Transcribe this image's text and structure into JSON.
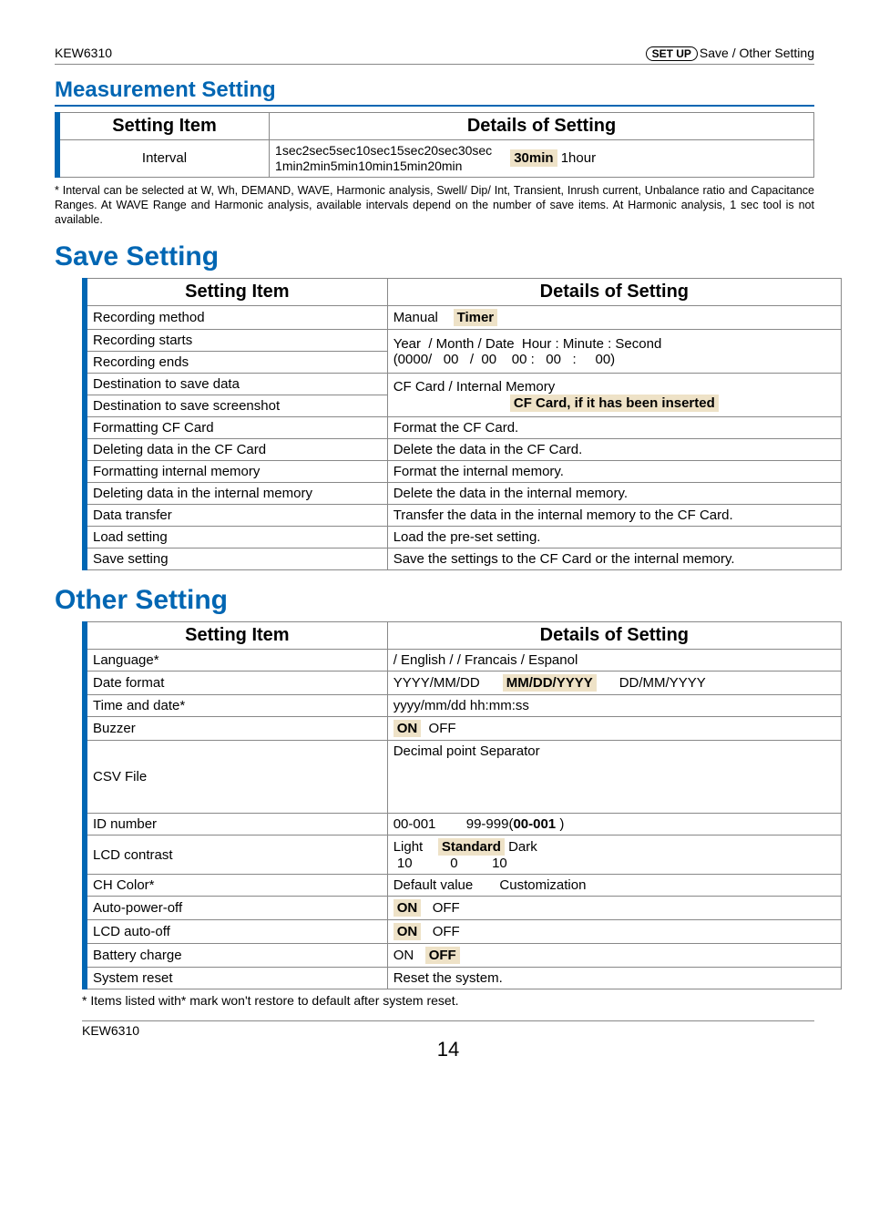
{
  "header": {
    "left": "KEW6310",
    "setup_label": "SET UP",
    "right_text": "Save / Other Setting"
  },
  "measurement": {
    "title": "Measurement Setting",
    "col1": "Setting Item",
    "col2": "Details of Setting",
    "row": {
      "item": "Interval",
      "line1": "1sec2sec5sec10sec15sec20sec30sec",
      "line2": "1min2min5min10min15min20min",
      "highlight": "30min",
      "after": " 1hour"
    },
    "footnote": "* Interval can be selected at W, Wh, DEMAND, WAVE, Harmonic analysis, Swell/ Dip/ Int, Transient, Inrush current, Unbalance ratio and Capacitance Ranges. At WAVE Range and Harmonic analysis, available intervals depend on the number of save items. At Harmonic analysis, 1 sec tool is not available."
  },
  "save": {
    "title": "Save Setting",
    "col1": "Setting Item",
    "col2": "Details of Setting",
    "rows": [
      {
        "item": "Recording method",
        "detail_pre": "Manual    ",
        "highlight": "Timer"
      },
      {
        "item": "Recording starts",
        "detail_plain": "Year  / Month / Date  Hour : Minute : Second"
      },
      {
        "item": "Recording ends",
        "detail_plain": "(0000/   00   /  00    00 :   00   :     00)"
      },
      {
        "item": "Destination to save data",
        "detail_plain": "CF Card / Internal Memory"
      },
      {
        "item": "Destination to save screenshot",
        "highlight_center": "CF Card, if it has been inserted"
      },
      {
        "item": "Formatting CF Card",
        "detail_plain": "Format the CF Card."
      },
      {
        "item": "Deleting data in the CF Card",
        "detail_plain": "Delete the data in the CF Card."
      },
      {
        "item": "Formatting internal memory",
        "detail_plain": "Format the internal memory."
      },
      {
        "item": "Deleting data in the internal memory",
        "detail_plain": "Delete the data in the internal memory."
      },
      {
        "item": "Data transfer",
        "detail_plain": "Transfer the data in the internal memory to the CF Card."
      },
      {
        "item": "Load setting",
        "detail_plain": "Load the pre-set setting."
      },
      {
        "item": "Save setting",
        "detail_plain": "Save the settings to the CF Card or the internal memory."
      }
    ]
  },
  "other": {
    "title": "Other Setting",
    "col1": "Setting Item",
    "col2": "Details of Setting",
    "rows": {
      "language": {
        "item": "Language*",
        "detail": "/ English /  / Francais / Espanol"
      },
      "dateformat": {
        "item": "Date format",
        "pre": "YYYY/MM/DD      ",
        "highlight": "MM/DD/YYYY",
        "post": "      DD/MM/YYYY"
      },
      "timedate": {
        "item": "Time and date*",
        "detail": "yyyy/mm/dd  hh:mm:ss"
      },
      "buzzer": {
        "item": "Buzzer",
        "highlight": "ON",
        "post": "  OFF"
      },
      "csv": {
        "item": "CSV File",
        "detail": "Decimal point   Separator"
      },
      "idnumber": {
        "item": "ID number",
        "pre": "00-001        99-999(",
        "highlight": "00-001",
        "post": " )"
      },
      "lcdcontrast": {
        "item": "LCD contrast",
        "line1_pre": "Light    ",
        "line1_hl": "Standard",
        "line1_post": " Dark",
        "line2": " 10          0         10"
      },
      "chcolor": {
        "item": "CH Color*",
        "detail": "Default value       Customization"
      },
      "autopoweroff": {
        "item": "Auto-power-off",
        "highlight": "ON",
        "post": "   OFF"
      },
      "lcdautooff": {
        "item": "LCD auto-off",
        "highlight": "ON",
        "post": "   OFF"
      },
      "batterycharge": {
        "item": "Battery charge",
        "pre": "ON   ",
        "highlight": "OFF"
      },
      "systemreset": {
        "item": "System reset",
        "detail": "Reset the system."
      }
    },
    "footnote": "* Items listed with*       mark won't restore to default after system reset."
  },
  "footer": {
    "model": "KEW6310",
    "page": "14"
  }
}
